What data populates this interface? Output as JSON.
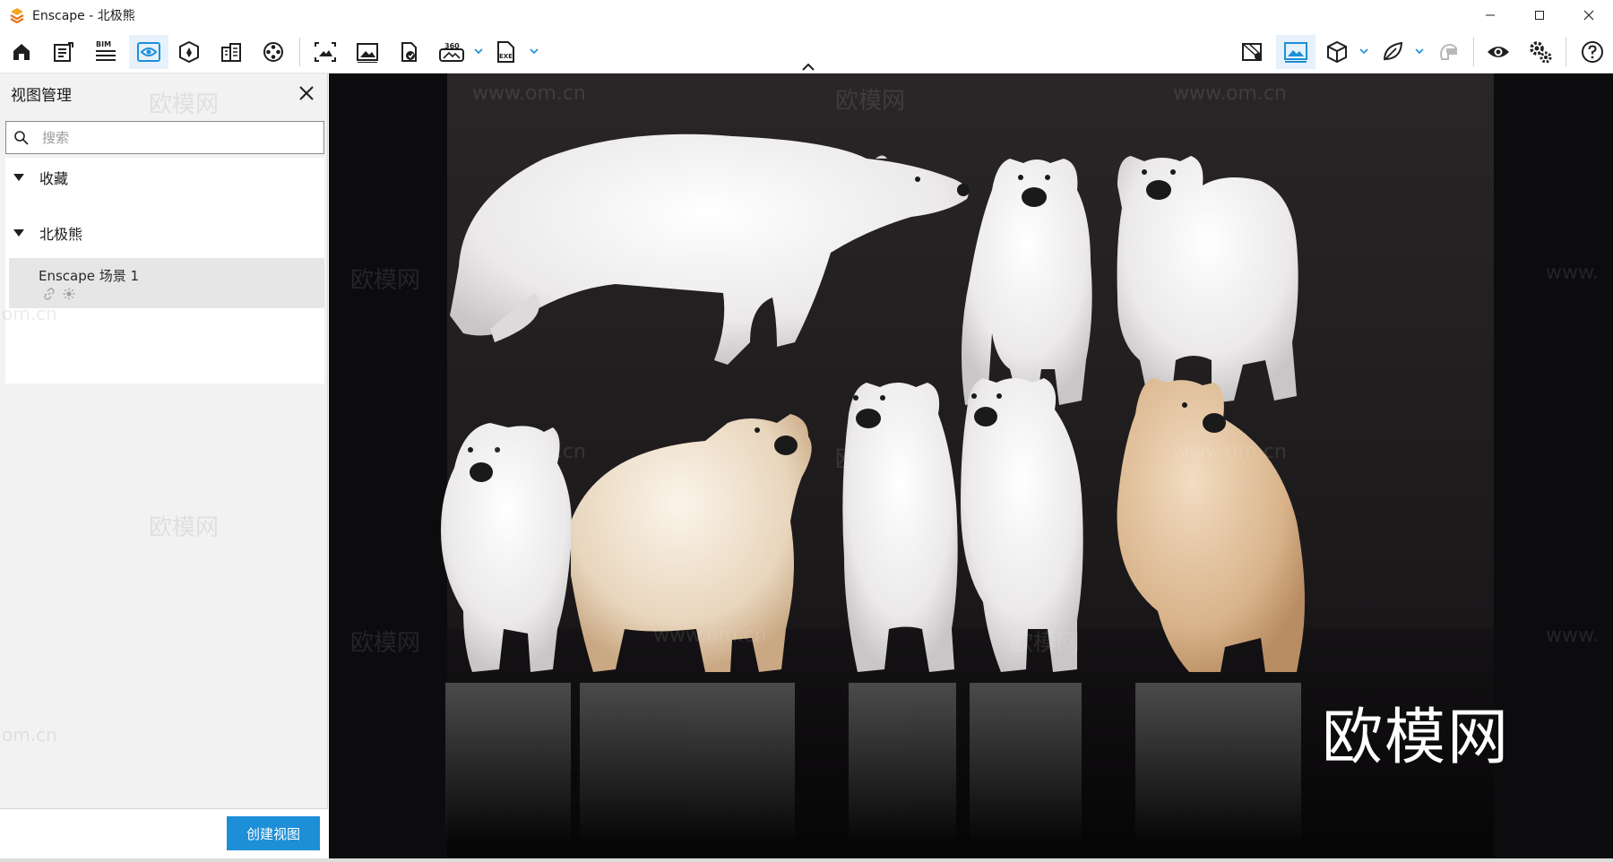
{
  "window": {
    "title": "Enscape - 北极熊"
  },
  "toolbar": {
    "left_icons": [
      "home-icon",
      "settings-sheet-icon",
      "bim-icon",
      "view-management-icon",
      "asset-library-icon",
      "site-context-icon",
      "video-editor-icon",
      "batch-render-icon",
      "screenshot-icon",
      "panorama-icon",
      "export-360-icon",
      "export-exe-icon"
    ],
    "bim_label": "BIM",
    "pano_label": "360",
    "exe_label": "EXE",
    "right_icons": [
      "map-icon",
      "visual-settings-icon",
      "cube-icon",
      "leaf-icon",
      "vr-headset-icon",
      "eye-icon",
      "gears-icon",
      "help-icon"
    ],
    "accent_color": "#1d8fd6"
  },
  "sidebar": {
    "title": "视图管理",
    "search_placeholder": "搜索",
    "sections": [
      {
        "label": "收藏"
      },
      {
        "label": "北极熊"
      }
    ],
    "view_item": {
      "name": "Enscape 场景 1",
      "icons": [
        "link-icon",
        "sun-icon"
      ]
    },
    "create_button": "创建视图",
    "watermarks": {
      "brand": "欧模网",
      "url": "om.cn"
    }
  },
  "viewport": {
    "brand_logo": "欧模网",
    "watermark_brand": "欧模网",
    "watermark_url": "www.om.cn",
    "watermark_url_partial": "www."
  }
}
